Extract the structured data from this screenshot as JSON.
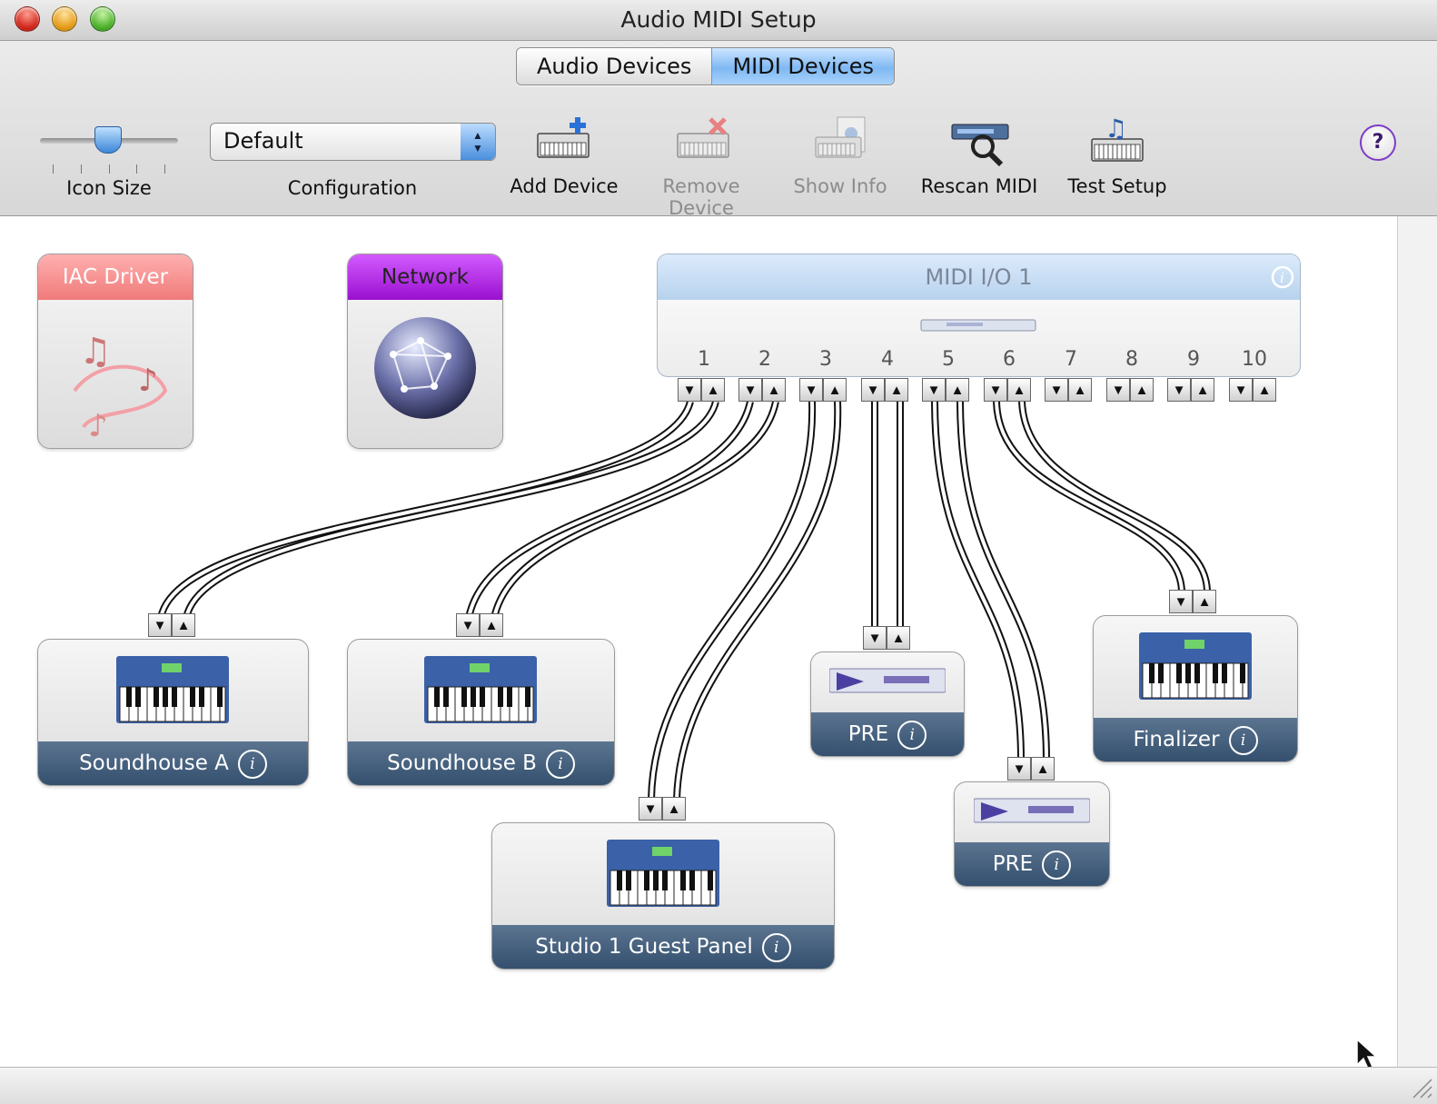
{
  "window": {
    "title": "Audio MIDI Setup"
  },
  "tabs": [
    {
      "label": "Audio Devices",
      "active": false
    },
    {
      "label": "MIDI Devices",
      "active": true
    }
  ],
  "toolbar": {
    "icon_size_label": "Icon Size",
    "configuration": {
      "value": "Default",
      "label": "Configuration"
    },
    "add_device": "Add Device",
    "remove_device": "Remove Device",
    "show_info": "Show Info",
    "rescan_midi": "Rescan MIDI",
    "test_setup": "Test Setup",
    "help": "?"
  },
  "devices": {
    "iac": {
      "name": "IAC Driver"
    },
    "network": {
      "name": "Network"
    },
    "midi_io": {
      "name": "MIDI I/O 1",
      "ports": [
        "1",
        "2",
        "3",
        "4",
        "5",
        "6",
        "7",
        "8",
        "9",
        "10"
      ]
    },
    "soundhouse_a": {
      "name": "Soundhouse A"
    },
    "soundhouse_b": {
      "name": "Soundhouse B"
    },
    "studio_panel": {
      "name": "Studio 1 Guest Panel"
    },
    "pre_1": {
      "name": "PRE"
    },
    "pre_2": {
      "name": "PRE"
    },
    "finalizer": {
      "name": "Finalizer"
    }
  },
  "colors": {
    "iac_header": "#f07a7a",
    "network_header": "#9a10cf",
    "device_footer": "#34506e",
    "tab_active": "#7fb8f3"
  },
  "icons": [
    "add-device-icon",
    "remove-device-icon",
    "show-info-icon",
    "rescan-midi-icon",
    "test-setup-icon",
    "help-icon",
    "keyboard-icon",
    "rack-unit-icon",
    "globe-icon",
    "music-notes-icon",
    "info-icon"
  ]
}
